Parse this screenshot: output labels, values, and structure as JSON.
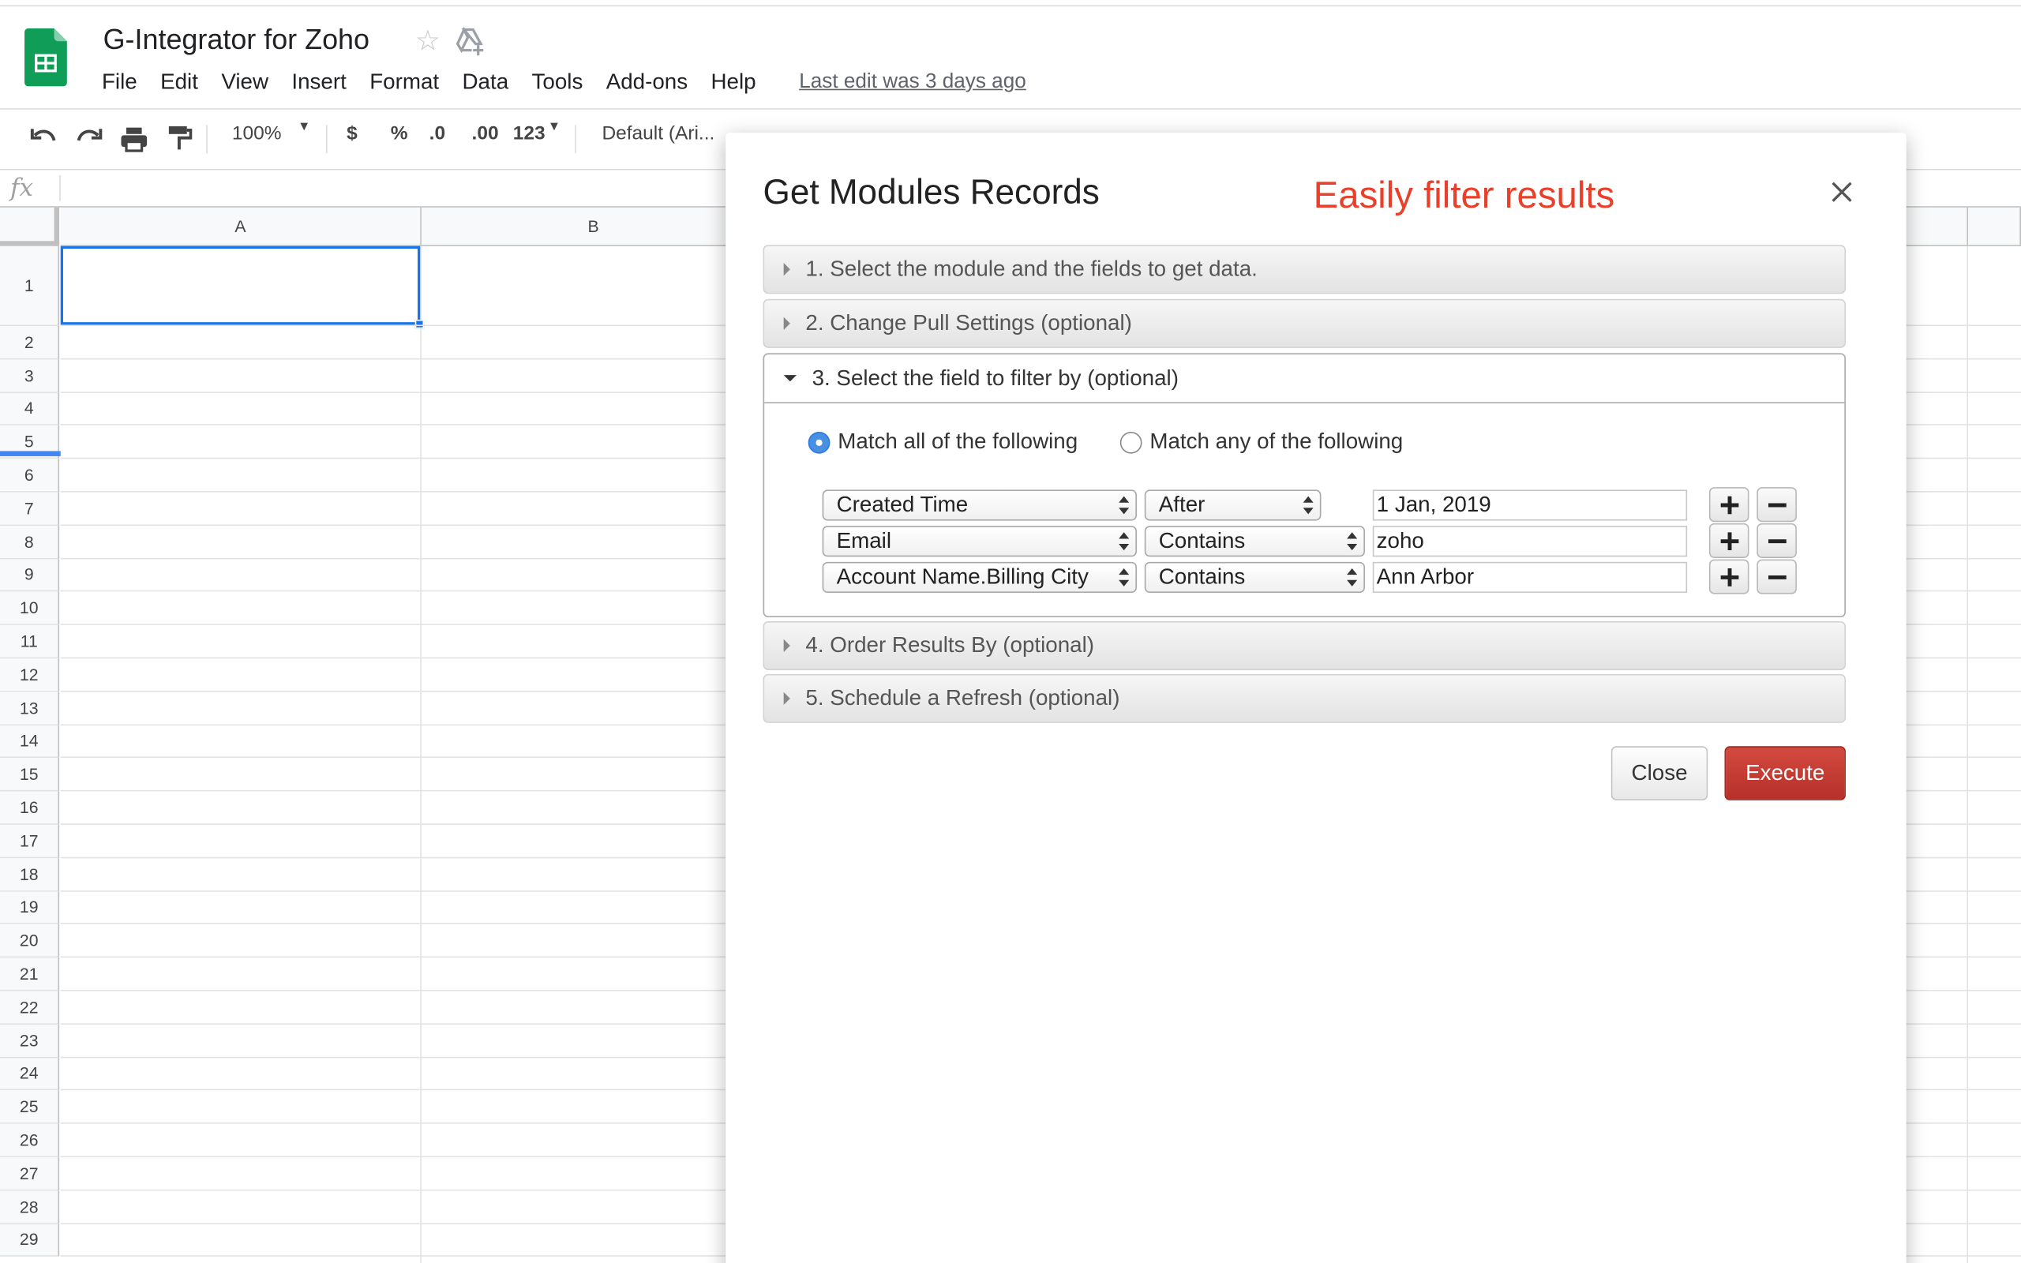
{
  "doc": {
    "title": "G-Integrator for Zoho",
    "last_edit": "Last edit was 3 days ago"
  },
  "menu": [
    "File",
    "Edit",
    "View",
    "Insert",
    "Format",
    "Data",
    "Tools",
    "Add-ons",
    "Help"
  ],
  "toolbar": {
    "zoom": "100%",
    "currency": "$",
    "percent": "%",
    "dec_decrease": ".0",
    "dec_increase": ".00",
    "more_formats": "123",
    "font": "Default (Ari..."
  },
  "formula_bar": {
    "fx_label": "fx"
  },
  "grid": {
    "columns": [
      "A",
      "B"
    ],
    "rows": [
      "1",
      "2",
      "3",
      "4",
      "5",
      "6",
      "7",
      "8",
      "9",
      "10",
      "11",
      "12",
      "13",
      "14",
      "15",
      "16",
      "17",
      "18",
      "19",
      "20",
      "21",
      "22",
      "23",
      "24",
      "25",
      "26",
      "27",
      "28",
      "29"
    ]
  },
  "dialog": {
    "title": "Get Modules Records",
    "annotation": "Easily filter results",
    "sections": [
      "1. Select the module and the fields to get data.",
      "2. Change Pull Settings (optional)",
      "3. Select the field to filter by (optional)",
      "4. Order Results By (optional)",
      "5. Schedule a Refresh (optional)"
    ],
    "match_all": "Match all of the following",
    "match_any": "Match any of the following",
    "filters": [
      {
        "field": "Created Time",
        "operator": "After",
        "value": "1 Jan, 2019"
      },
      {
        "field": "Email",
        "operator": "Contains",
        "value": "zoho"
      },
      {
        "field": "Account Name.Billing City",
        "operator": "Contains",
        "value": "Ann Arbor"
      }
    ],
    "close_label": "Close",
    "execute_label": "Execute"
  },
  "colors": {
    "annotation": "#e8402a",
    "execute_button": "#c0392b",
    "selection": "#1a73e8",
    "sheets_green": "#0f9d58"
  }
}
